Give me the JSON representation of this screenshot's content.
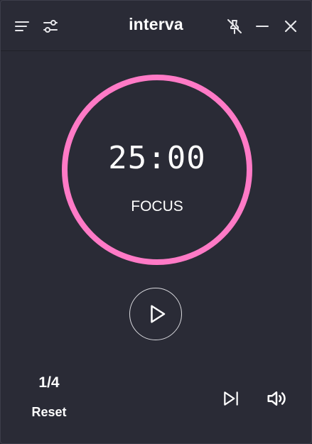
{
  "app": {
    "title": "interva"
  },
  "titlebar": {
    "menu_icon": "menu-lines-icon",
    "settings_icon": "sliders-icon",
    "pin_icon": "pin-off-icon",
    "minimize_icon": "minimize-icon",
    "close_icon": "close-icon"
  },
  "timer": {
    "time": "25:00",
    "mode": "FOCUS",
    "ring_color": "#ff7ac6",
    "progress": 1.0
  },
  "controls": {
    "play_icon": "play-icon",
    "skip_icon": "skip-forward-icon",
    "volume_icon": "volume-icon"
  },
  "session": {
    "round": "1/4",
    "reset_label": "Reset"
  },
  "colors": {
    "background": "#2a2b36",
    "accent": "#ff7ac6",
    "text": "#ffffff"
  }
}
